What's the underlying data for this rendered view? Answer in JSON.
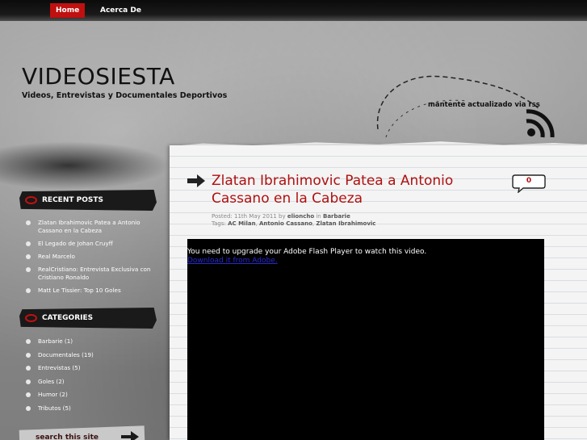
{
  "nav": {
    "home": "Home",
    "about": "Acerca De"
  },
  "header": {
    "title": "VIDEOSIESTA",
    "tagline": "Videos, Entrevistas y Documentales Deportivos",
    "rss_text": "mantente actualizado via rss"
  },
  "sidebar": {
    "recent_posts": {
      "heading": "RECENT POSTS",
      "items": [
        "Zlatan Ibrahimovic Patea a Antonio Cassano en la Cabeza",
        "El Legado de Johan Cruyff",
        "Real Marcelo",
        "RealCristiano: Entrevista Exclusiva con Cristiano Ronaldo",
        "Matt Le Tissier: Top 10 Goles"
      ]
    },
    "categories": {
      "heading": "CATEGORIES",
      "items": [
        "Barbarie (1)",
        "Documentales (19)",
        "Entrevistas (5)",
        "Goles (2)",
        "Humor (2)",
        "Tributos (5)"
      ]
    },
    "search_label": "search this site"
  },
  "post": {
    "title": "Zlatan Ibrahimovic Patea a Antonio Cassano en la Cabeza",
    "comment_count": "0",
    "posted_prefix": "Posted: ",
    "date": "11th May 2011",
    "by": " by ",
    "author": "elioncho",
    "in": " in ",
    "category": "Barbarie",
    "tags_prefix": "Tags: ",
    "tags": [
      "AC Milan",
      "Antonio Cassano",
      "Zlatan Ibrahimovic"
    ],
    "tag_sep": ", "
  },
  "video": {
    "message": "You need to upgrade your Adobe Flash Player to watch this video.",
    "link": "Download it from Adobe."
  },
  "colors": {
    "accent": "#c01010",
    "title_red": "#b01010"
  }
}
